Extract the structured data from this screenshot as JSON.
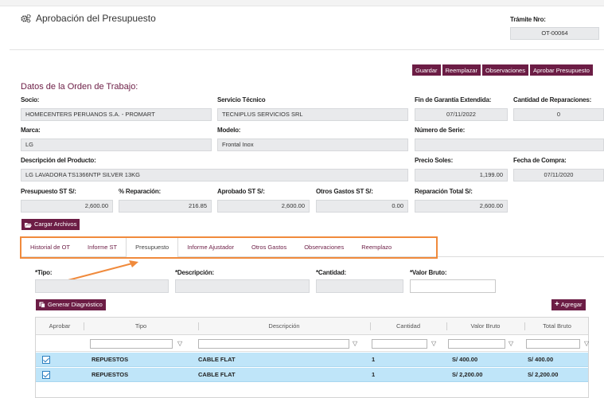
{
  "header": {
    "title": "Aprobación del Presupuesto",
    "tramite_label": "Trámite Nro:",
    "tramite_value": "OT-00064"
  },
  "toolbar": {
    "guardar": "Guardar",
    "reemplazar": "Reemplazar",
    "observaciones": "Observaciones",
    "aprobar": "Aprobar Presupuesto"
  },
  "section": {
    "title": "Datos de la Orden de Trabajo:"
  },
  "form": {
    "socio_label": "Socio:",
    "socio_value": "HOMECENTERS PERUANOS S.A. - PROMART",
    "servicio_label": "Servicio Técnico",
    "servicio_value": "TECNIPLUS SERVICIOS SRL",
    "garantia_label": "Fin de Garantía Extendida:",
    "garantia_value": "07/11/2022",
    "cantidad_rep_label": "Cantidad de Reparaciones:",
    "cantidad_rep_value": "0",
    "marca_label": "Marca:",
    "marca_value": "LG",
    "modelo_label": "Modelo:",
    "modelo_value": "Frontal Inox",
    "serie_label": "Número de Serie:",
    "serie_value": "",
    "descripcion_label": "Descripción del Producto:",
    "descripcion_value": "LG LAVADORA  TS1366NTP SILVER 13KG",
    "precio_label": "Precio Soles:",
    "precio_value": "1,199.00",
    "fecha_label": "Fecha de Compra:",
    "fecha_value": "07/11/2020",
    "presupuesto_label": "Presupuesto ST S/:",
    "presupuesto_value": "2,600.00",
    "porc_label": "% Reparación:",
    "porc_value": "216.85",
    "aprobado_label": "Aprobado ST S/:",
    "aprobado_value": "2,600.00",
    "otros_label": "Otros Gastos ST S/:",
    "otros_value": "0.00",
    "total_label": "Reparación Total S/:",
    "total_value": "2,600.00",
    "cargar_label": "Cargar Archivos"
  },
  "tabs": [
    "Historial de OT",
    "Informe ST",
    "Presupuesto",
    "Informe Ajustador",
    "Otros Gastos",
    "Observaciones",
    "Reemplazo"
  ],
  "budget_form": {
    "tipo_label": "*Tipo:",
    "descripcion_label": "*Descripción:",
    "cantidad_label": "*Cantidad:",
    "valor_label": "*Valor Bruto:",
    "generar_label": "Generar Diagnóstico",
    "agregar_label": "Agregar"
  },
  "grid": {
    "columns": [
      "Aprobar",
      "Tipo",
      "Descripción",
      "Cantidad",
      "Valor Bruto",
      "Total Bruto"
    ],
    "rows": [
      {
        "tipo": "REPUESTOS",
        "descripcion": "CABLE FLAT",
        "cantidad": "1",
        "valor": "S/ 400.00",
        "total": "S/ 400.00"
      },
      {
        "tipo": "REPUESTOS",
        "descripcion": "CABLE FLAT",
        "cantidad": "1",
        "valor": "S/ 2,200.00",
        "total": "S/ 2,200.00"
      }
    ]
  },
  "colors": {
    "accent": "#6c1d45",
    "highlight": "#f08a3c",
    "row_selected": "#bfe5f9"
  }
}
